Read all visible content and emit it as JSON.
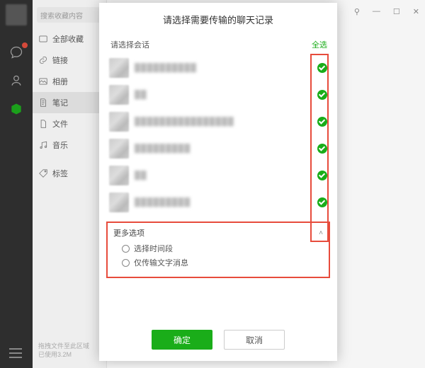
{
  "sidebar": {
    "search_placeholder": "搜索收藏内容",
    "items": [
      {
        "label": "全部收藏"
      },
      {
        "label": "链接"
      },
      {
        "label": "相册"
      },
      {
        "label": "笔记"
      },
      {
        "label": "文件"
      },
      {
        "label": "音乐"
      },
      {
        "label": "标签"
      }
    ],
    "storage_line1": "拖拽文件至此区域",
    "storage_line2": "已使用3.2M"
  },
  "window": {
    "pin": "⚲",
    "min": "—",
    "max": "☐",
    "close": "✕"
  },
  "dialog": {
    "title": "请选择需要传输的聊天记录",
    "select_label": "请选择会话",
    "select_all": "全选",
    "chats": [
      {
        "name": "██████████"
      },
      {
        "name": "██"
      },
      {
        "name": "████████████████"
      },
      {
        "name": "█████████"
      },
      {
        "name": "██"
      },
      {
        "name": "█████████"
      }
    ],
    "more_label": "更多选项",
    "options": [
      {
        "label": "选择时间段"
      },
      {
        "label": "仅传输文字消息"
      }
    ],
    "ok": "确定",
    "cancel": "取消"
  }
}
